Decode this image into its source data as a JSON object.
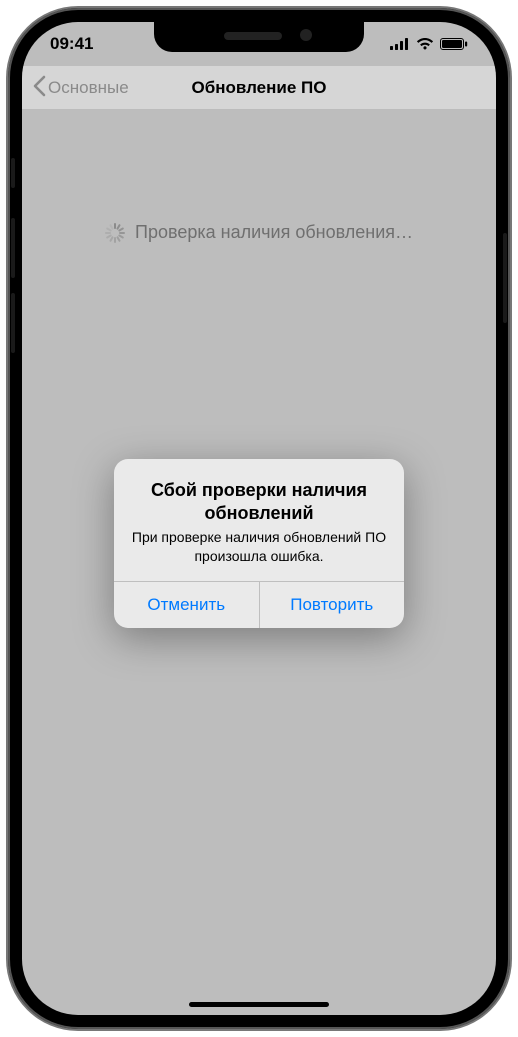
{
  "status": {
    "time": "09:41"
  },
  "navbar": {
    "back_label": "Основные",
    "title": "Обновление ПО"
  },
  "content": {
    "checking_label": "Проверка наличия обновления…"
  },
  "alert": {
    "title": "Сбой проверки наличия обновлений",
    "message": "При проверке наличия обновлений ПО произошла ошибка.",
    "cancel_label": "Отменить",
    "retry_label": "Повторить"
  },
  "colors": {
    "accent": "#007aff"
  }
}
